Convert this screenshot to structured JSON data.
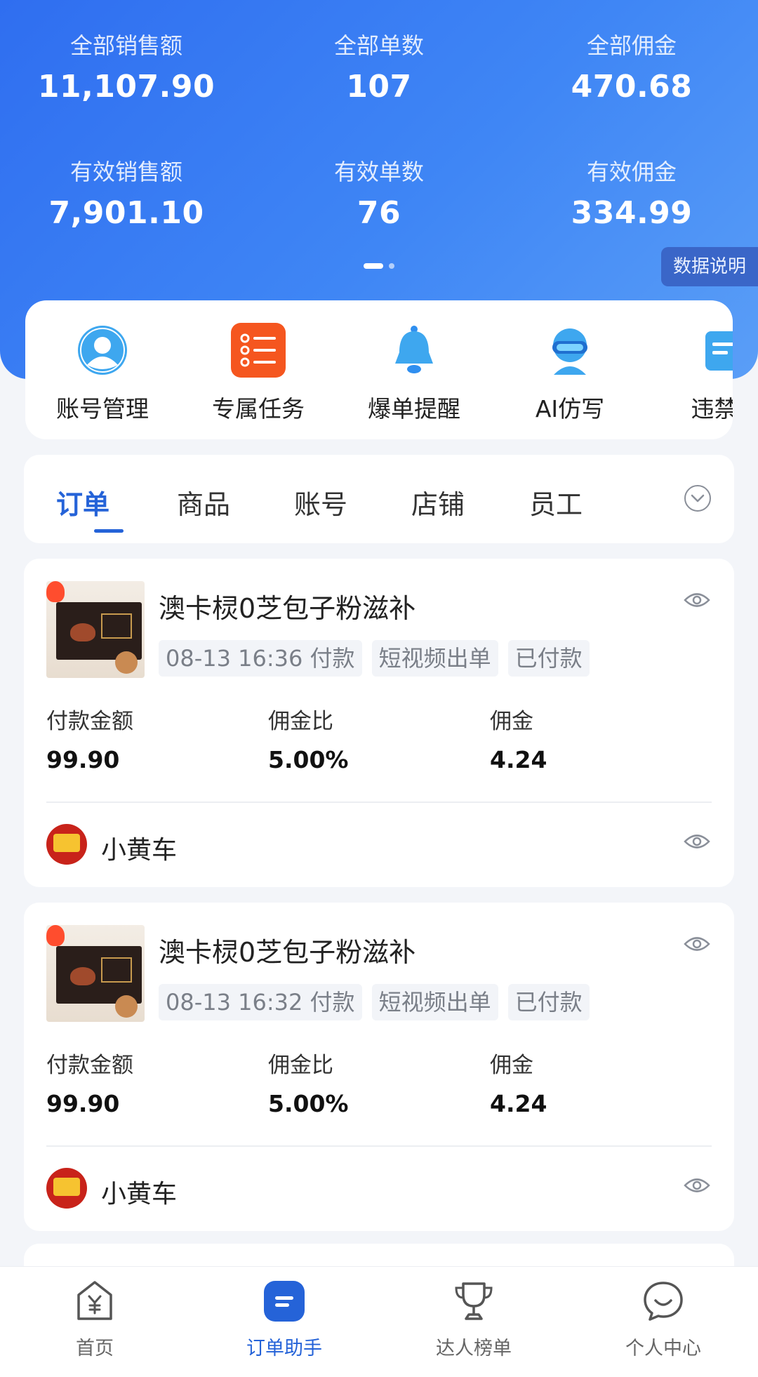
{
  "stats": {
    "total_sales_label": "全部销售额",
    "total_sales": "11,107.90",
    "total_orders_label": "全部单数",
    "total_orders": "107",
    "total_commission_label": "全部佣金",
    "total_commission": "470.68",
    "valid_sales_label": "有效销售额",
    "valid_sales": "7,901.10",
    "valid_orders_label": "有效单数",
    "valid_orders": "76",
    "valid_commission_label": "有效佣金",
    "valid_commission": "334.99"
  },
  "data_note_label": "数据说明",
  "quick_actions": [
    {
      "label": "账号管理",
      "icon": "user-icon"
    },
    {
      "label": "专属任务",
      "icon": "task-list-icon"
    },
    {
      "label": "爆单提醒",
      "icon": "bell-icon"
    },
    {
      "label": "AI仿写",
      "icon": "ai-robot-icon"
    },
    {
      "label": "违禁词",
      "icon": "document-icon"
    }
  ],
  "tabs": [
    "订单",
    "商品",
    "账号",
    "店铺",
    "员工"
  ],
  "orders": [
    {
      "title": "澳卡棂0芝包子粉滋补",
      "tags": [
        "08-13 16:36 付款",
        "短视频出单",
        "已付款"
      ],
      "amount_label": "付款金额",
      "amount": "99.90",
      "rate_label": "佣金比",
      "rate": "5.00%",
      "commission_label": "佣金",
      "commission": "4.24",
      "shop": "小黄车"
    },
    {
      "title": "澳卡棂0芝包子粉滋补",
      "tags": [
        "08-13 16:32 付款",
        "短视频出单",
        "已付款"
      ],
      "amount_label": "付款金额",
      "amount": "99.90",
      "rate_label": "佣金比",
      "rate": "5.00%",
      "commission_label": "佣金",
      "commission": "4.24",
      "shop": "小黄车"
    }
  ],
  "bottom_nav": [
    {
      "label": "首页",
      "icon": "yuan-home-icon"
    },
    {
      "label": "订单助手",
      "icon": "order-assistant-icon"
    },
    {
      "label": "达人榜单",
      "icon": "trophy-icon"
    },
    {
      "label": "个人中心",
      "icon": "chat-smile-icon"
    }
  ],
  "colors": {
    "accent": "#2563d8",
    "hero_start": "#2f6ef0",
    "hero_end": "#5a9ef7",
    "task_orange": "#f5561f",
    "shop_red": "#c8231a"
  }
}
